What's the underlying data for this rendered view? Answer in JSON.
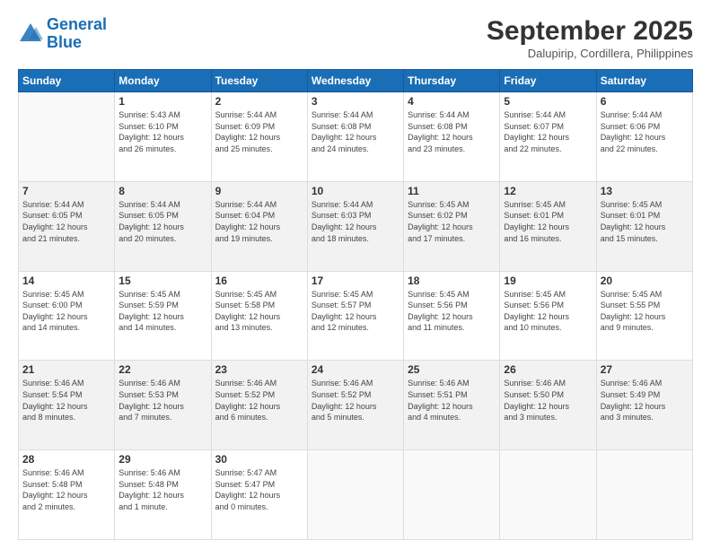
{
  "header": {
    "logo_line1": "General",
    "logo_line2": "Blue",
    "month": "September 2025",
    "location": "Dalupirip, Cordillera, Philippines"
  },
  "weekdays": [
    "Sunday",
    "Monday",
    "Tuesday",
    "Wednesday",
    "Thursday",
    "Friday",
    "Saturday"
  ],
  "rows": [
    [
      {
        "day": "",
        "info": ""
      },
      {
        "day": "1",
        "info": "Sunrise: 5:43 AM\nSunset: 6:10 PM\nDaylight: 12 hours\nand 26 minutes."
      },
      {
        "day": "2",
        "info": "Sunrise: 5:44 AM\nSunset: 6:09 PM\nDaylight: 12 hours\nand 25 minutes."
      },
      {
        "day": "3",
        "info": "Sunrise: 5:44 AM\nSunset: 6:08 PM\nDaylight: 12 hours\nand 24 minutes."
      },
      {
        "day": "4",
        "info": "Sunrise: 5:44 AM\nSunset: 6:08 PM\nDaylight: 12 hours\nand 23 minutes."
      },
      {
        "day": "5",
        "info": "Sunrise: 5:44 AM\nSunset: 6:07 PM\nDaylight: 12 hours\nand 22 minutes."
      },
      {
        "day": "6",
        "info": "Sunrise: 5:44 AM\nSunset: 6:06 PM\nDaylight: 12 hours\nand 22 minutes."
      }
    ],
    [
      {
        "day": "7",
        "info": "Sunrise: 5:44 AM\nSunset: 6:05 PM\nDaylight: 12 hours\nand 21 minutes."
      },
      {
        "day": "8",
        "info": "Sunrise: 5:44 AM\nSunset: 6:05 PM\nDaylight: 12 hours\nand 20 minutes."
      },
      {
        "day": "9",
        "info": "Sunrise: 5:44 AM\nSunset: 6:04 PM\nDaylight: 12 hours\nand 19 minutes."
      },
      {
        "day": "10",
        "info": "Sunrise: 5:44 AM\nSunset: 6:03 PM\nDaylight: 12 hours\nand 18 minutes."
      },
      {
        "day": "11",
        "info": "Sunrise: 5:45 AM\nSunset: 6:02 PM\nDaylight: 12 hours\nand 17 minutes."
      },
      {
        "day": "12",
        "info": "Sunrise: 5:45 AM\nSunset: 6:01 PM\nDaylight: 12 hours\nand 16 minutes."
      },
      {
        "day": "13",
        "info": "Sunrise: 5:45 AM\nSunset: 6:01 PM\nDaylight: 12 hours\nand 15 minutes."
      }
    ],
    [
      {
        "day": "14",
        "info": "Sunrise: 5:45 AM\nSunset: 6:00 PM\nDaylight: 12 hours\nand 14 minutes."
      },
      {
        "day": "15",
        "info": "Sunrise: 5:45 AM\nSunset: 5:59 PM\nDaylight: 12 hours\nand 14 minutes."
      },
      {
        "day": "16",
        "info": "Sunrise: 5:45 AM\nSunset: 5:58 PM\nDaylight: 12 hours\nand 13 minutes."
      },
      {
        "day": "17",
        "info": "Sunrise: 5:45 AM\nSunset: 5:57 PM\nDaylight: 12 hours\nand 12 minutes."
      },
      {
        "day": "18",
        "info": "Sunrise: 5:45 AM\nSunset: 5:56 PM\nDaylight: 12 hours\nand 11 minutes."
      },
      {
        "day": "19",
        "info": "Sunrise: 5:45 AM\nSunset: 5:56 PM\nDaylight: 12 hours\nand 10 minutes."
      },
      {
        "day": "20",
        "info": "Sunrise: 5:45 AM\nSunset: 5:55 PM\nDaylight: 12 hours\nand 9 minutes."
      }
    ],
    [
      {
        "day": "21",
        "info": "Sunrise: 5:46 AM\nSunset: 5:54 PM\nDaylight: 12 hours\nand 8 minutes."
      },
      {
        "day": "22",
        "info": "Sunrise: 5:46 AM\nSunset: 5:53 PM\nDaylight: 12 hours\nand 7 minutes."
      },
      {
        "day": "23",
        "info": "Sunrise: 5:46 AM\nSunset: 5:52 PM\nDaylight: 12 hours\nand 6 minutes."
      },
      {
        "day": "24",
        "info": "Sunrise: 5:46 AM\nSunset: 5:52 PM\nDaylight: 12 hours\nand 5 minutes."
      },
      {
        "day": "25",
        "info": "Sunrise: 5:46 AM\nSunset: 5:51 PM\nDaylight: 12 hours\nand 4 minutes."
      },
      {
        "day": "26",
        "info": "Sunrise: 5:46 AM\nSunset: 5:50 PM\nDaylight: 12 hours\nand 3 minutes."
      },
      {
        "day": "27",
        "info": "Sunrise: 5:46 AM\nSunset: 5:49 PM\nDaylight: 12 hours\nand 3 minutes."
      }
    ],
    [
      {
        "day": "28",
        "info": "Sunrise: 5:46 AM\nSunset: 5:48 PM\nDaylight: 12 hours\nand 2 minutes."
      },
      {
        "day": "29",
        "info": "Sunrise: 5:46 AM\nSunset: 5:48 PM\nDaylight: 12 hours\nand 1 minute."
      },
      {
        "day": "30",
        "info": "Sunrise: 5:47 AM\nSunset: 5:47 PM\nDaylight: 12 hours\nand 0 minutes."
      },
      {
        "day": "",
        "info": ""
      },
      {
        "day": "",
        "info": ""
      },
      {
        "day": "",
        "info": ""
      },
      {
        "day": "",
        "info": ""
      }
    ]
  ]
}
